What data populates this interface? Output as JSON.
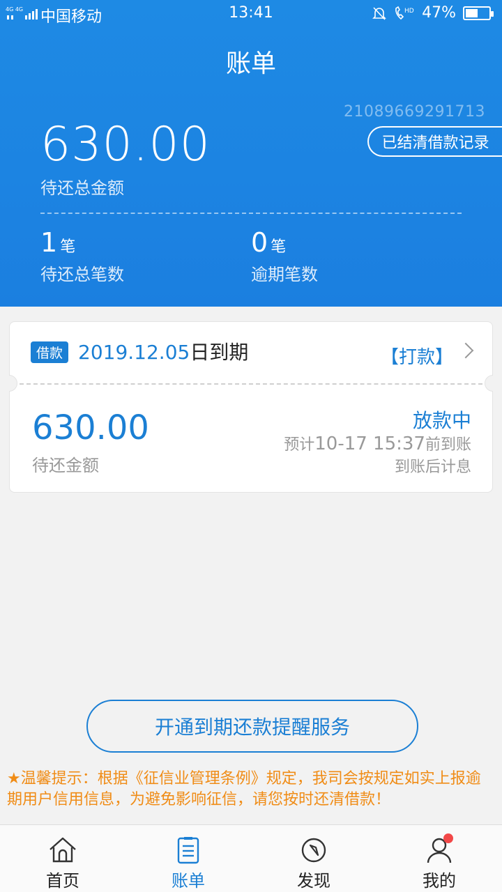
{
  "status_bar": {
    "network": "4G 4G",
    "carrier": "中国移动",
    "time": "13:41",
    "hd": "HD",
    "battery": "47%",
    "battery_level": 0.47
  },
  "header": {
    "title": "账单",
    "loan_id": "21089669291713",
    "settled_button": "已结清借款记录",
    "total_amount": "630.00",
    "total_label": "待还总金额",
    "count_value": "1",
    "count_unit": "笔",
    "count_label": "待还总笔数",
    "overdue_value": "0",
    "overdue_unit": "笔",
    "overdue_label": "逾期笔数"
  },
  "loan_card": {
    "tag": "借款",
    "due_date": "2019.12.05",
    "due_suffix": "日到期",
    "action": "【打款】",
    "amount": "630.00",
    "amount_label": "待还金额",
    "status": "放款中",
    "eta_prefix": "预计",
    "eta_time": "10-17 15:37",
    "eta_suffix": "前到账",
    "interest_note": "到账后计息"
  },
  "remind_button": "开通到期还款提醒服务",
  "tip": "★温馨提示：根据《征信业管理条例》规定，我司会按规定如实上报逾期用户信用信息，为避免影响征信，请您按时还清借款！",
  "tabs": [
    {
      "label": "首页",
      "icon": "home-icon"
    },
    {
      "label": "账单",
      "icon": "bill-icon"
    },
    {
      "label": "发现",
      "icon": "compass-icon"
    },
    {
      "label": "我的",
      "icon": "user-icon"
    }
  ],
  "colors": {
    "header_blue": "#1e8ae4",
    "accent": "#1b7fd4",
    "tip_orange": "#f08c16",
    "badge_red": "#f24848"
  }
}
